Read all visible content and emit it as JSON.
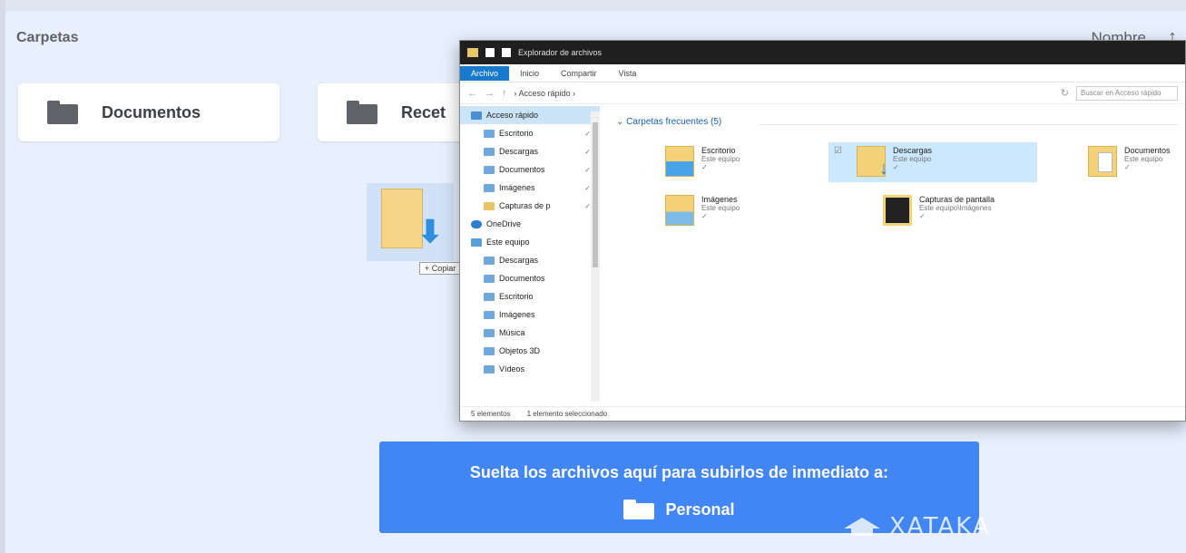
{
  "header": {
    "section_title": "Carpetas",
    "sort_label": "Nombre",
    "sort_arrow": "↑"
  },
  "folders": [
    {
      "name": "Documentos"
    },
    {
      "name": "Recet"
    }
  ],
  "drag": {
    "tooltip": "+ Copiar"
  },
  "explorer": {
    "title": "Explorador de archivos",
    "tabs": [
      "Archivo",
      "Inicio",
      "Compartir",
      "Vista"
    ],
    "path": "› Acceso rápido ›",
    "search_placeholder": "Buscar en Acceso rápido",
    "nav": [
      {
        "label": "Acceso rápido",
        "icon": "star-icon",
        "pin": ""
      },
      {
        "label": "Escritorio",
        "icon": "desktop-icon",
        "pin": "✓"
      },
      {
        "label": "Descargas",
        "icon": "download-icon",
        "pin": "✓"
      },
      {
        "label": "Documentos",
        "icon": "document-icon",
        "pin": "✓"
      },
      {
        "label": "Imágenes",
        "icon": "image-icon",
        "pin": "✓"
      },
      {
        "label": "Capturas de p",
        "icon": "folder-icon",
        "pin": "✓"
      },
      {
        "label": "OneDrive",
        "icon": "cloud-icon",
        "pin": ""
      },
      {
        "label": "Este equipo",
        "icon": "pc-icon",
        "pin": ""
      },
      {
        "label": "Descargas",
        "icon": "download-icon",
        "pin": ""
      },
      {
        "label": "Documentos",
        "icon": "document-icon",
        "pin": ""
      },
      {
        "label": "Escritorio",
        "icon": "desktop-icon",
        "pin": ""
      },
      {
        "label": "Imágenes",
        "icon": "image-icon",
        "pin": ""
      },
      {
        "label": "Música",
        "icon": "music-icon",
        "pin": ""
      },
      {
        "label": "Objetos 3D",
        "icon": "cube-icon",
        "pin": ""
      },
      {
        "label": "Vídeos",
        "icon": "video-icon",
        "pin": ""
      }
    ],
    "group_header": "⌄ Carpetas frecuentes (5)",
    "tiles": [
      {
        "name": "Escritorio",
        "sub": "Este equipo",
        "pin": "✓"
      },
      {
        "name": "Descargas",
        "sub": "Este equipo",
        "pin": "✓"
      },
      {
        "name": "Documentos",
        "sub": "Este equipo",
        "pin": "✓"
      },
      {
        "name": "Imágenes",
        "sub": "Este equipo",
        "pin": "✓"
      },
      {
        "name": "Capturas de pantalla",
        "sub": "Este equipo\\Imágenes",
        "pin": "✓"
      }
    ],
    "status": {
      "count": "5 elementos",
      "selected": "1 elemento seleccionado"
    }
  },
  "dropzone": {
    "message": "Suelta los archivos aquí para subirlos de inmediato a:",
    "destination": "Personal"
  },
  "watermark": {
    "text": "XATAKA"
  },
  "colors": {
    "banner": "#4285f4",
    "background": "#e8f0fe",
    "selection": "#cce8ff"
  }
}
